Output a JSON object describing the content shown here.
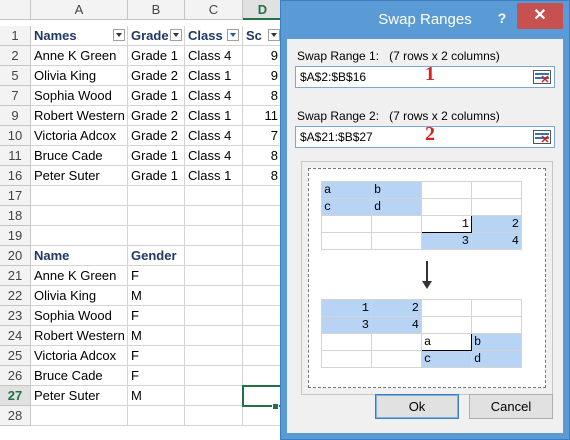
{
  "sheet": {
    "columns": [
      "A",
      "B",
      "C",
      "D"
    ],
    "header_row": {
      "num": "1",
      "a": "Names",
      "b": "Grade",
      "c": "Class",
      "d": "Sc"
    },
    "rows": [
      {
        "num": "2",
        "a": "Anne K Green",
        "b": "Grade 1",
        "c": "Class 4",
        "d": "9"
      },
      {
        "num": "5",
        "a": "Olivia King",
        "b": "Grade 2",
        "c": "Class 1",
        "d": "9"
      },
      {
        "num": "7",
        "a": "Sophia Wood",
        "b": "Grade 1",
        "c": "Class 4",
        "d": "8"
      },
      {
        "num": "9",
        "a": "Robert  Western",
        "b": "Grade 2",
        "c": "Class 1",
        "d": "11"
      },
      {
        "num": "10",
        "a": "Victoria  Adcox",
        "b": "Grade 2",
        "c": "Class 4",
        "d": "7"
      },
      {
        "num": "11",
        "a": "Bruce Cade",
        "b": "Grade 1",
        "c": "Class 4",
        "d": "8"
      },
      {
        "num": "16",
        "a": "Peter Suter",
        "b": "Grade 1",
        "c": "Class 1",
        "d": "8"
      },
      {
        "num": "17",
        "a": "",
        "b": "",
        "c": "",
        "d": ""
      },
      {
        "num": "18",
        "a": "",
        "b": "",
        "c": "",
        "d": ""
      },
      {
        "num": "19",
        "a": "",
        "b": "",
        "c": "",
        "d": ""
      },
      {
        "num": "20",
        "a": "Name",
        "b": "Gender",
        "c": "",
        "d": ""
      },
      {
        "num": "21",
        "a": "Anne K Green",
        "b": "F",
        "c": "",
        "d": ""
      },
      {
        "num": "22",
        "a": "Olivia King",
        "b": "M",
        "c": "",
        "d": ""
      },
      {
        "num": "23",
        "a": "Sophia Wood",
        "b": "F",
        "c": "",
        "d": ""
      },
      {
        "num": "24",
        "a": "Robert  Western",
        "b": "M",
        "c": "",
        "d": ""
      },
      {
        "num": "25",
        "a": "Victoria  Adcox",
        "b": "F",
        "c": "",
        "d": ""
      },
      {
        "num": "26",
        "a": "Bruce Cade",
        "b": "F",
        "c": "",
        "d": ""
      },
      {
        "num": "27",
        "a": "Peter Suter",
        "b": "M",
        "c": "",
        "d": ""
      },
      {
        "num": "28",
        "a": "",
        "b": "",
        "c": "",
        "d": ""
      }
    ]
  },
  "dialog": {
    "title": "Swap Ranges",
    "help": "?",
    "close": "✕",
    "range1": {
      "label": "Swap Range 1:",
      "info": "(7 rows x 2 columns)",
      "value": "$A$2:$B$16",
      "badge": "1"
    },
    "range2": {
      "label": "Swap Range 2:",
      "info": "(7 rows x 2 columns)",
      "value": "$A$21:$B$27",
      "badge": "2"
    },
    "preview": {
      "before": [
        [
          "a",
          "b",
          "",
          ""
        ],
        [
          "c",
          "d",
          "",
          ""
        ],
        [
          "",
          "",
          "1",
          "2"
        ],
        [
          "",
          "",
          "3",
          "4"
        ]
      ],
      "after": [
        [
          "1",
          "2",
          "",
          ""
        ],
        [
          "3",
          "4",
          "",
          ""
        ],
        [
          "",
          "",
          "a",
          "b"
        ],
        [
          "",
          "",
          "c",
          "d"
        ]
      ]
    },
    "ok": "Ok",
    "cancel": "Cancel"
  }
}
